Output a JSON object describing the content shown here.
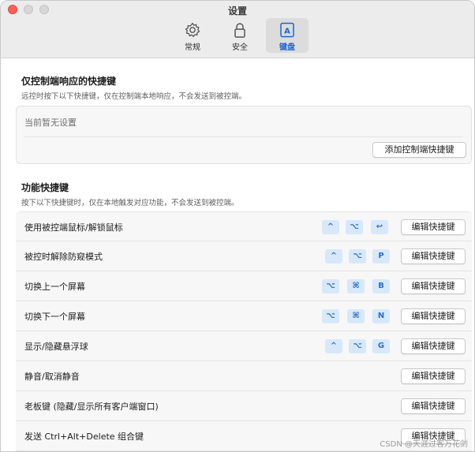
{
  "window": {
    "title": "设置"
  },
  "tabs": [
    {
      "label": "常规",
      "icon": "gear-icon",
      "active": false
    },
    {
      "label": "安全",
      "icon": "lock-icon",
      "active": false
    },
    {
      "label": "键盘",
      "icon": "keyboard-icon",
      "active": true
    }
  ],
  "controller_section": {
    "title": "仅控制端响应的快捷键",
    "description": "远控时按下以下快捷键，仅在控制端本地响应，不会发送到被控端。",
    "empty_text": "当前暂无设置",
    "add_button": "添加控制端快捷键"
  },
  "function_section": {
    "title": "功能快捷键",
    "description": "按下以下快捷键时，仅在本地触发对应功能，不会发送到被控端。",
    "edit_label": "编辑快捷键",
    "rows": [
      {
        "label": "使用被控端鼠标/解锁鼠标",
        "keys": [
          "^",
          "⌥",
          "↩"
        ]
      },
      {
        "label": "被控时解除防窥模式",
        "keys": [
          "^",
          "⌥",
          "P"
        ]
      },
      {
        "label": "切换上一个屏幕",
        "keys": [
          "⌥",
          "⌘",
          "B"
        ]
      },
      {
        "label": "切换下一个屏幕",
        "keys": [
          "⌥",
          "⌘",
          "N"
        ]
      },
      {
        "label": "显示/隐藏悬浮球",
        "keys": [
          "^",
          "⌥",
          "G"
        ]
      },
      {
        "label": "静音/取消静音",
        "keys": []
      },
      {
        "label": "老板键 (隐藏/显示所有客户端窗口)",
        "keys": []
      },
      {
        "label": "发送 Ctrl+Alt+Delete 组合键",
        "keys": []
      }
    ]
  },
  "watermark": "CSDN @天涯过客万花剑"
}
